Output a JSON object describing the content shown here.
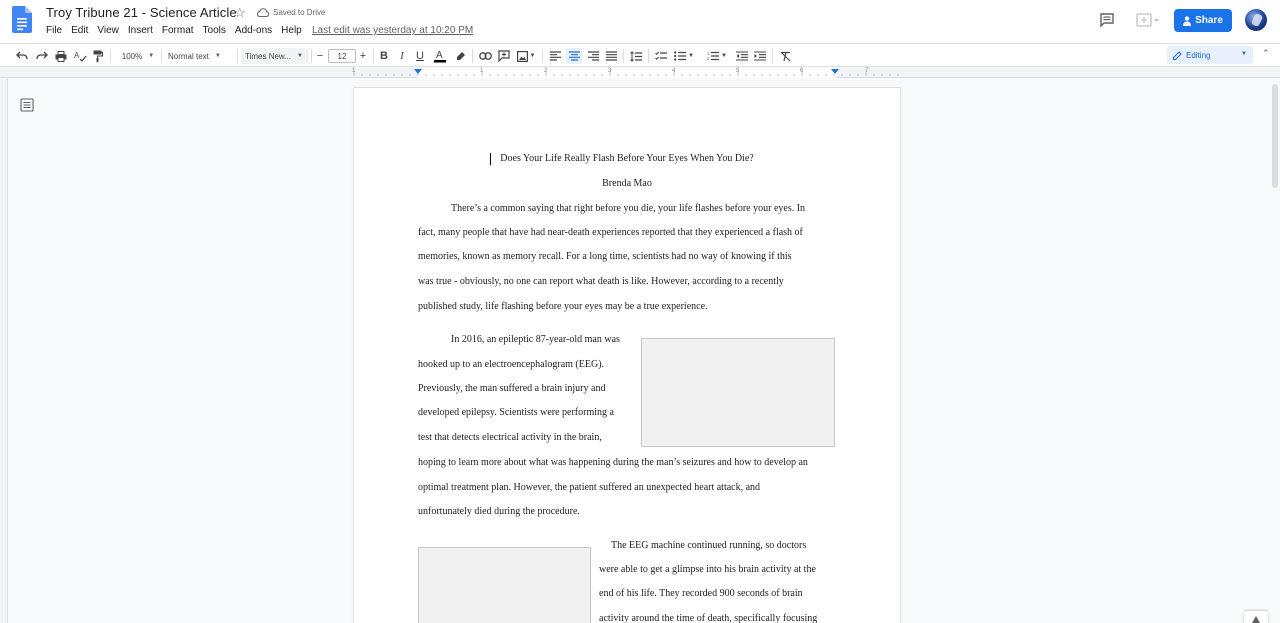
{
  "header": {
    "doc_title": "Troy Tribune 21 - Science Article",
    "saved_status": "Saved to Drive",
    "last_edit": "Last edit was yesterday at 10:20 PM",
    "share_label": "Share",
    "menus": [
      "File",
      "Edit",
      "View",
      "Insert",
      "Format",
      "Tools",
      "Add-ons",
      "Help"
    ]
  },
  "toolbar": {
    "zoom": "100%",
    "style": "Normal text",
    "font": "Times New...",
    "font_size": "12",
    "editing_mode": "Editing"
  },
  "ruler": {
    "numbers": [
      "1",
      "1",
      "2",
      "3",
      "4",
      "5",
      "6",
      "7"
    ]
  },
  "document": {
    "title": "Does Your Life Really Flash Before Your Eyes When You Die?",
    "author": "Brenda Mao",
    "p1_lines": [
      "There’s a common saying that right before you die, your life flashes before your eyes. In",
      "fact, many people that have had near-death experiences reported that they experienced a flash of",
      "memories, known as memory recall. For a long time, scientists had no way of knowing if this",
      "was true - obviously, no one can report what death is like. However, according to a recently",
      "published study, life flashing before your eyes may be a true experience."
    ],
    "p2_lines": [
      "In 2016, an epileptic 87-year-old man was",
      "hooked up to an electroencephalogram (EEG).",
      "Previously, the man suffered a brain injury and",
      "developed epilepsy. Scientists were performing a",
      "test that detects electrical activity in the brain,",
      "hoping to learn more about what was happening during the man’s seizures and how to develop an",
      "optimal treatment plan. However, the patient suffered an unexpected heart attack, and",
      "unfortunately died during the procedure."
    ],
    "p3_lines": [
      "The EEG machine continued running, so doctors",
      "were able to get a glimpse into his brain activity at the",
      "end of his life. They recorded 900 seconds of brain",
      "activity around the time of death, specifically focusing"
    ]
  },
  "colors": {
    "accent": "#1a73e8",
    "doc_blue": "#4285f4"
  }
}
